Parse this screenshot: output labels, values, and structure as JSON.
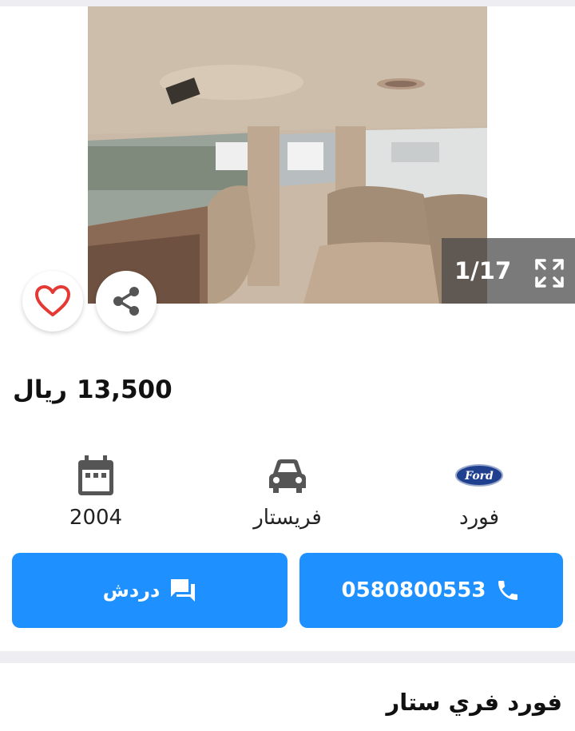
{
  "gallery": {
    "counter": "1/17"
  },
  "price": {
    "amount": "13,500",
    "currency": "ريال"
  },
  "specs": {
    "year": "2004",
    "model": "فريستار",
    "make": "فورد",
    "make_logo_text": "Ford"
  },
  "actions": {
    "chat_label": "دردش",
    "phone": "0580800553"
  },
  "listing": {
    "title": "فورد فري ستار"
  },
  "icons": {
    "prev": "chevron-left-icon",
    "next": "chevron-right-icon",
    "expand": "fullscreen-icon",
    "favorite": "heart-icon",
    "share": "share-icon",
    "calendar": "calendar-icon",
    "car": "car-icon",
    "brand": "ford-logo",
    "chat": "chat-icon",
    "phone": "phone-icon"
  },
  "colors": {
    "accent": "#1e90ff",
    "favorite": "#e53935",
    "icon_gray": "#555555"
  }
}
